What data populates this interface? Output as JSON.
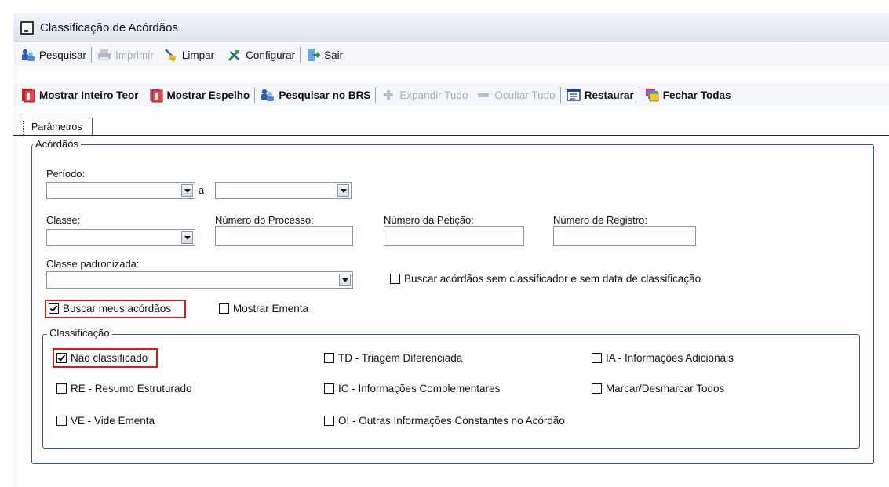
{
  "window": {
    "title": "Classificação de Acórdãos"
  },
  "toolbar1": [
    {
      "name": "pesquisar",
      "label": "Pesquisar",
      "accel": "P",
      "icon": "search-people-icon",
      "disabled": false
    },
    {
      "name": "imprimir",
      "label": "Imprimir",
      "accel": "I",
      "icon": "printer-icon",
      "disabled": true
    },
    {
      "name": "limpar",
      "label": "Limpar",
      "accel": "L",
      "icon": "broom-icon",
      "disabled": false
    },
    {
      "name": "configurar",
      "label": "Configurar",
      "accel": "C",
      "icon": "tools-icon",
      "disabled": false
    },
    {
      "name": "sair",
      "label": "Sair",
      "accel": "S",
      "icon": "exit-icon",
      "disabled": false
    }
  ],
  "toolbar2": [
    {
      "name": "mostrar-inteiro-teor",
      "label": "Mostrar Inteiro Teor",
      "icon": "document-red-icon",
      "disabled": false
    },
    {
      "name": "mostrar-espelho",
      "label": "Mostrar Espelho",
      "icon": "document-red-icon",
      "disabled": false
    },
    {
      "name": "pesquisar-brs",
      "label": "Pesquisar no BRS",
      "icon": "search-people-icon",
      "disabled": false
    },
    {
      "name": "expandir-tudo",
      "label": "Expandir Tudo",
      "icon": "plus-icon",
      "disabled": true
    },
    {
      "name": "ocultar-tudo",
      "label": "Ocultar Tudo",
      "icon": "minus-icon",
      "disabled": true
    },
    {
      "name": "restaurar",
      "label": "Restaurar",
      "accel": "R",
      "icon": "restore-window-icon",
      "disabled": false
    },
    {
      "name": "fechar-todas",
      "label": "Fechar Todas",
      "icon": "close-windows-icon",
      "disabled": false
    }
  ],
  "tab": {
    "label": "Parâmetros"
  },
  "acordaos": {
    "legend": "Acórdãos",
    "periodo_label": "Período:",
    "periodo_sep": "a",
    "periodo_inicio": "",
    "periodo_fim": "",
    "classe_label": "Classe:",
    "classe_value": "",
    "numero_processo_label": "Número do Processo:",
    "numero_peticao_label": "Número da Petição:",
    "numero_registro_label": "Número de Registro:",
    "classe_padronizada_label": "Classe padronizada:",
    "classe_padronizada_value": "",
    "sem_classificador": {
      "label": "Buscar acórdãos sem classificador e sem data de classificação",
      "checked": false
    },
    "buscar_meus": {
      "label": "Buscar meus acórdãos",
      "checked": true
    },
    "mostrar_ementa": {
      "label": "Mostrar Ementa",
      "checked": false
    }
  },
  "classificacao": {
    "legend": "Classificação",
    "nao_classificado": {
      "label": "Não classificado",
      "checked": true
    },
    "td": {
      "label": "TD - Triagem Diferenciada",
      "checked": false
    },
    "ia": {
      "label": "IA - Informações Adicionais",
      "checked": false
    },
    "re": {
      "label": "RE - Resumo Estruturado",
      "checked": false
    },
    "ic": {
      "label": "IC - Informações Complementares",
      "checked": false
    },
    "marcar_todos": {
      "label": "Marcar/Desmarcar Todos",
      "checked": false
    },
    "ve": {
      "label": "VE - Vide Ementa",
      "checked": false
    },
    "oi": {
      "label": "OI - Outras Informações Constantes no Acórdão",
      "checked": false
    }
  },
  "colors": {
    "group_border": "#3a5792",
    "highlight": "#d21c1c"
  }
}
